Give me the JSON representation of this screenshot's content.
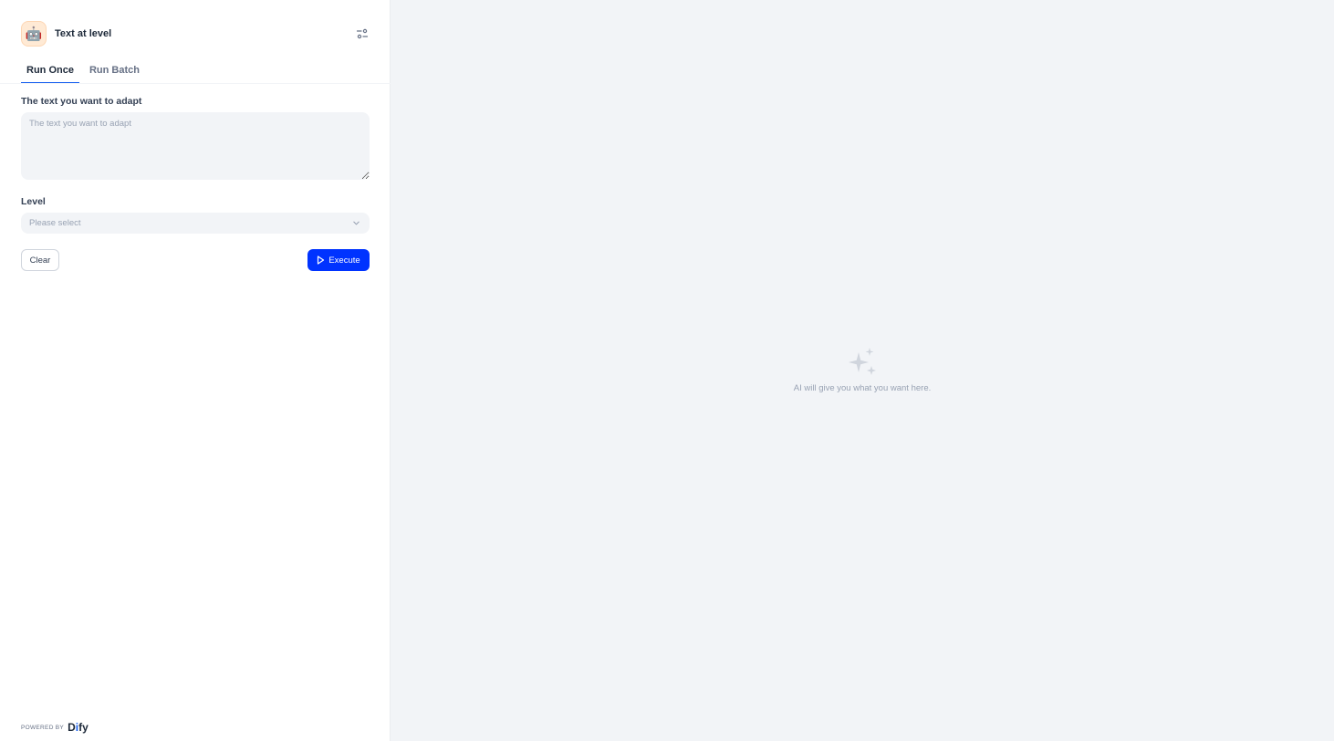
{
  "app": {
    "title": "Text at level",
    "icon_emoji": "🤖",
    "icon_bg": "#ffead5"
  },
  "tabs": [
    {
      "label": "Run Once",
      "active": true
    },
    {
      "label": "Run Batch",
      "active": false
    }
  ],
  "form": {
    "text_field": {
      "label": "The text you want to adapt",
      "placeholder": "The text you want to adapt",
      "value": ""
    },
    "level_field": {
      "label": "Level",
      "placeholder": "Please select"
    }
  },
  "buttons": {
    "clear_label": "Clear",
    "execute_label": "Execute"
  },
  "footer": {
    "powered_by": "POWERED BY",
    "brand": "Dify"
  },
  "result_panel": {
    "empty_text": "AI will give you what you want here."
  },
  "colors": {
    "accent": "#0033ff",
    "tab_underline": "#155eef",
    "panel_bg": "#f2f4f7"
  },
  "icons": {
    "settings": "sliders-icon",
    "execute": "play-icon",
    "select": "chevron-down-icon",
    "empty": "sparkles-icon"
  }
}
